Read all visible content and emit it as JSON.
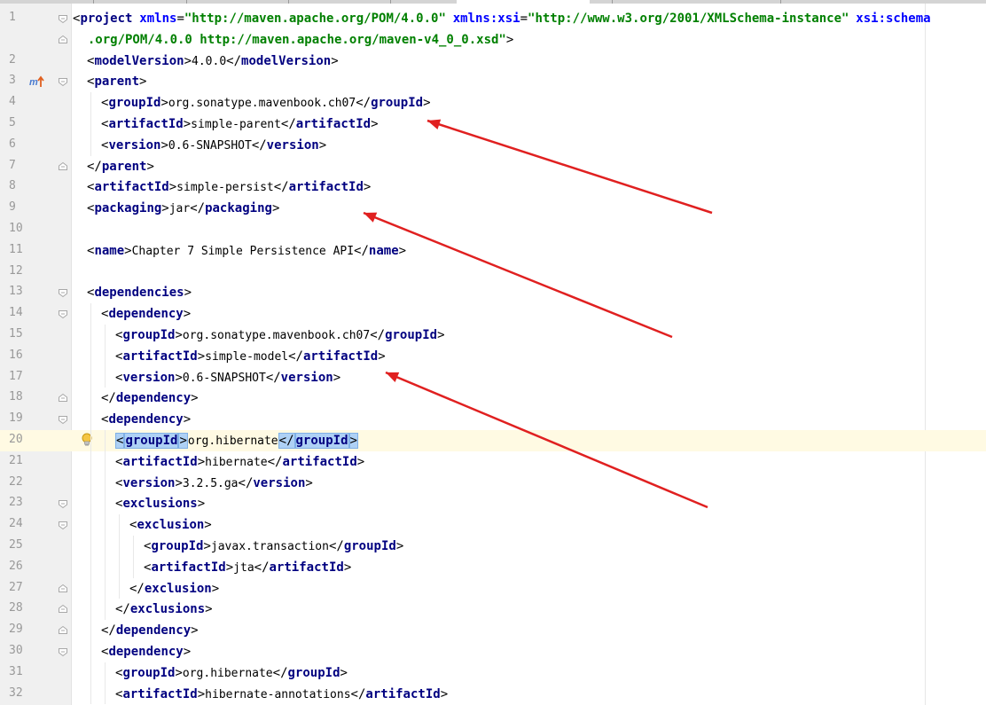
{
  "editor": {
    "file_type": "Maven POM (pom.xml)",
    "caret_line": 20
  },
  "lines": [
    {
      "n": "1",
      "fold": "open",
      "indent": 0,
      "parts": [
        [
          "br",
          "<"
        ],
        [
          "tag",
          "project"
        ],
        [
          "txt",
          " "
        ],
        [
          "attr",
          "xmlns"
        ],
        [
          "br",
          "="
        ],
        [
          "val",
          "\"http://maven.apache.org/POM/4.0.0\""
        ],
        [
          "txt",
          " "
        ],
        [
          "attr",
          "xmlns:xsi"
        ],
        [
          "br",
          "="
        ],
        [
          "val",
          "\"http://www.w3.org/2001/XMLSchema-instance\""
        ],
        [
          "txt",
          " "
        ],
        [
          "attr",
          "xsi:schema"
        ]
      ]
    },
    {
      "n": "",
      "fold": "close",
      "indent": 0,
      "parts": [
        [
          "val",
          "  .org/POM/4.0.0 http://maven.apache.org/maven-v4_0_0.xsd\""
        ],
        [
          "br",
          ">"
        ]
      ]
    },
    {
      "n": "2",
      "indent": 1,
      "parts": [
        [
          "br",
          "<"
        ],
        [
          "tag",
          "modelVersion"
        ],
        [
          "br",
          ">"
        ],
        [
          "txt",
          "4.0.0"
        ],
        [
          "br",
          "</"
        ],
        [
          "tag",
          "modelVersion"
        ],
        [
          "br",
          ">"
        ]
      ]
    },
    {
      "n": "3",
      "fold": "open",
      "icon": "maven-override",
      "indent": 1,
      "parts": [
        [
          "br",
          "<"
        ],
        [
          "tag",
          "parent"
        ],
        [
          "br",
          ">"
        ]
      ]
    },
    {
      "n": "4",
      "indent": 2,
      "parts": [
        [
          "br",
          "<"
        ],
        [
          "tag",
          "groupId"
        ],
        [
          "br",
          ">"
        ],
        [
          "txt",
          "org.sonatype.mavenbook.ch07"
        ],
        [
          "br",
          "</"
        ],
        [
          "tag",
          "groupId"
        ],
        [
          "br",
          ">"
        ]
      ]
    },
    {
      "n": "5",
      "indent": 2,
      "parts": [
        [
          "br",
          "<"
        ],
        [
          "tag",
          "artifactId"
        ],
        [
          "br",
          ">"
        ],
        [
          "txt",
          "simple-parent"
        ],
        [
          "br",
          "</"
        ],
        [
          "tag",
          "artifactId"
        ],
        [
          "br",
          ">"
        ]
      ]
    },
    {
      "n": "6",
      "indent": 2,
      "parts": [
        [
          "br",
          "<"
        ],
        [
          "tag",
          "version"
        ],
        [
          "br",
          ">"
        ],
        [
          "txt",
          "0.6-SNAPSHOT"
        ],
        [
          "br",
          "</"
        ],
        [
          "tag",
          "version"
        ],
        [
          "br",
          ">"
        ]
      ]
    },
    {
      "n": "7",
      "fold": "close",
      "indent": 1,
      "parts": [
        [
          "br",
          "</"
        ],
        [
          "tag",
          "parent"
        ],
        [
          "br",
          ">"
        ]
      ]
    },
    {
      "n": "8",
      "indent": 1,
      "parts": [
        [
          "br",
          "<"
        ],
        [
          "tag",
          "artifactId"
        ],
        [
          "br",
          ">"
        ],
        [
          "txt",
          "simple-persist"
        ],
        [
          "br",
          "</"
        ],
        [
          "tag",
          "artifactId"
        ],
        [
          "br",
          ">"
        ]
      ]
    },
    {
      "n": "9",
      "indent": 1,
      "parts": [
        [
          "br",
          "<"
        ],
        [
          "tag",
          "packaging"
        ],
        [
          "br",
          ">"
        ],
        [
          "txt",
          "jar"
        ],
        [
          "br",
          "</"
        ],
        [
          "tag",
          "packaging"
        ],
        [
          "br",
          ">"
        ]
      ]
    },
    {
      "n": "10",
      "indent": 1,
      "parts": []
    },
    {
      "n": "11",
      "indent": 1,
      "parts": [
        [
          "br",
          "<"
        ],
        [
          "tag",
          "name"
        ],
        [
          "br",
          ">"
        ],
        [
          "txt",
          "Chapter 7 Simple Persistence API"
        ],
        [
          "br",
          "</"
        ],
        [
          "tag",
          "name"
        ],
        [
          "br",
          ">"
        ]
      ]
    },
    {
      "n": "12",
      "indent": 1,
      "parts": []
    },
    {
      "n": "13",
      "fold": "open",
      "indent": 1,
      "parts": [
        [
          "br",
          "<"
        ],
        [
          "tag",
          "dependencies"
        ],
        [
          "br",
          ">"
        ]
      ]
    },
    {
      "n": "14",
      "fold": "open",
      "indent": 2,
      "parts": [
        [
          "br",
          "<"
        ],
        [
          "tag",
          "dependency"
        ],
        [
          "br",
          ">"
        ]
      ]
    },
    {
      "n": "15",
      "indent": 3,
      "parts": [
        [
          "br",
          "<"
        ],
        [
          "tag",
          "groupId"
        ],
        [
          "br",
          ">"
        ],
        [
          "txt",
          "org.sonatype.mavenbook.ch07"
        ],
        [
          "br",
          "</"
        ],
        [
          "tag",
          "groupId"
        ],
        [
          "br",
          ">"
        ]
      ]
    },
    {
      "n": "16",
      "indent": 3,
      "parts": [
        [
          "br",
          "<"
        ],
        [
          "tag",
          "artifactId"
        ],
        [
          "br",
          ">"
        ],
        [
          "txt",
          "simple-model"
        ],
        [
          "br",
          "</"
        ],
        [
          "tag",
          "artifactId"
        ],
        [
          "br",
          ">"
        ]
      ]
    },
    {
      "n": "17",
      "indent": 3,
      "parts": [
        [
          "br",
          "<"
        ],
        [
          "tag",
          "version"
        ],
        [
          "br",
          ">"
        ],
        [
          "txt",
          "0.6-SNAPSHOT"
        ],
        [
          "br",
          "</"
        ],
        [
          "tag",
          "version"
        ],
        [
          "br",
          ">"
        ]
      ]
    },
    {
      "n": "18",
      "fold": "close",
      "indent": 2,
      "parts": [
        [
          "br",
          "</"
        ],
        [
          "tag",
          "dependency"
        ],
        [
          "br",
          ">"
        ]
      ]
    },
    {
      "n": "19",
      "fold": "open",
      "indent": 2,
      "parts": [
        [
          "br",
          "<"
        ],
        [
          "tag",
          "dependency"
        ],
        [
          "br",
          ">"
        ]
      ]
    },
    {
      "n": "20",
      "icon": "bulb",
      "caret": true,
      "indent": 3,
      "parts": [
        [
          "hlbr",
          "<"
        ],
        [
          "hltag",
          "groupId"
        ],
        [
          "hlbr",
          ">"
        ],
        [
          "txt",
          "org.hibernate"
        ],
        [
          "hlbr",
          "</"
        ],
        [
          "hltag",
          "groupId"
        ],
        [
          "hlbr",
          ">"
        ]
      ]
    },
    {
      "n": "21",
      "indent": 3,
      "parts": [
        [
          "br",
          "<"
        ],
        [
          "tag",
          "artifactId"
        ],
        [
          "br",
          ">"
        ],
        [
          "txt",
          "hibernate"
        ],
        [
          "br",
          "</"
        ],
        [
          "tag",
          "artifactId"
        ],
        [
          "br",
          ">"
        ]
      ]
    },
    {
      "n": "22",
      "indent": 3,
      "parts": [
        [
          "br",
          "<"
        ],
        [
          "tag",
          "version"
        ],
        [
          "br",
          ">"
        ],
        [
          "txt",
          "3.2.5.ga"
        ],
        [
          "br",
          "</"
        ],
        [
          "tag",
          "version"
        ],
        [
          "br",
          ">"
        ]
      ]
    },
    {
      "n": "23",
      "fold": "open",
      "indent": 3,
      "parts": [
        [
          "br",
          "<"
        ],
        [
          "tag",
          "exclusions"
        ],
        [
          "br",
          ">"
        ]
      ]
    },
    {
      "n": "24",
      "fold": "open",
      "indent": 4,
      "parts": [
        [
          "br",
          "<"
        ],
        [
          "tag",
          "exclusion"
        ],
        [
          "br",
          ">"
        ]
      ]
    },
    {
      "n": "25",
      "indent": 5,
      "parts": [
        [
          "br",
          "<"
        ],
        [
          "tag",
          "groupId"
        ],
        [
          "br",
          ">"
        ],
        [
          "txt",
          "javax.transaction"
        ],
        [
          "br",
          "</"
        ],
        [
          "tag",
          "groupId"
        ],
        [
          "br",
          ">"
        ]
      ]
    },
    {
      "n": "26",
      "indent": 5,
      "parts": [
        [
          "br",
          "<"
        ],
        [
          "tag",
          "artifactId"
        ],
        [
          "br",
          ">"
        ],
        [
          "txt",
          "jta"
        ],
        [
          "br",
          "</"
        ],
        [
          "tag",
          "artifactId"
        ],
        [
          "br",
          ">"
        ]
      ]
    },
    {
      "n": "27",
      "fold": "close",
      "indent": 4,
      "parts": [
        [
          "br",
          "</"
        ],
        [
          "tag",
          "exclusion"
        ],
        [
          "br",
          ">"
        ]
      ]
    },
    {
      "n": "28",
      "fold": "close",
      "indent": 3,
      "parts": [
        [
          "br",
          "</"
        ],
        [
          "tag",
          "exclusions"
        ],
        [
          "br",
          ">"
        ]
      ]
    },
    {
      "n": "29",
      "fold": "close",
      "indent": 2,
      "parts": [
        [
          "br",
          "</"
        ],
        [
          "tag",
          "dependency"
        ],
        [
          "br",
          ">"
        ]
      ]
    },
    {
      "n": "30",
      "fold": "open",
      "indent": 2,
      "parts": [
        [
          "br",
          "<"
        ],
        [
          "tag",
          "dependency"
        ],
        [
          "br",
          ">"
        ]
      ]
    },
    {
      "n": "31",
      "indent": 3,
      "parts": [
        [
          "br",
          "<"
        ],
        [
          "tag",
          "groupId"
        ],
        [
          "br",
          ">"
        ],
        [
          "txt",
          "org.hibernate"
        ],
        [
          "br",
          "</"
        ],
        [
          "tag",
          "groupId"
        ],
        [
          "br",
          ">"
        ]
      ]
    },
    {
      "n": "32",
      "indent": 3,
      "parts": [
        [
          "br",
          "<"
        ],
        [
          "tag",
          "artifactId"
        ],
        [
          "br",
          ">"
        ],
        [
          "txt",
          "hibernate-annotations"
        ],
        [
          "br",
          "</"
        ],
        [
          "tag",
          "artifactId"
        ],
        [
          "br",
          ">"
        ]
      ]
    }
  ],
  "annotations": {
    "color": "#e02020",
    "arrows": [
      {
        "name": "arrow-to-parent-group"
      },
      {
        "name": "arrow-to-packaging"
      },
      {
        "name": "arrow-to-dependency-version"
      }
    ]
  }
}
